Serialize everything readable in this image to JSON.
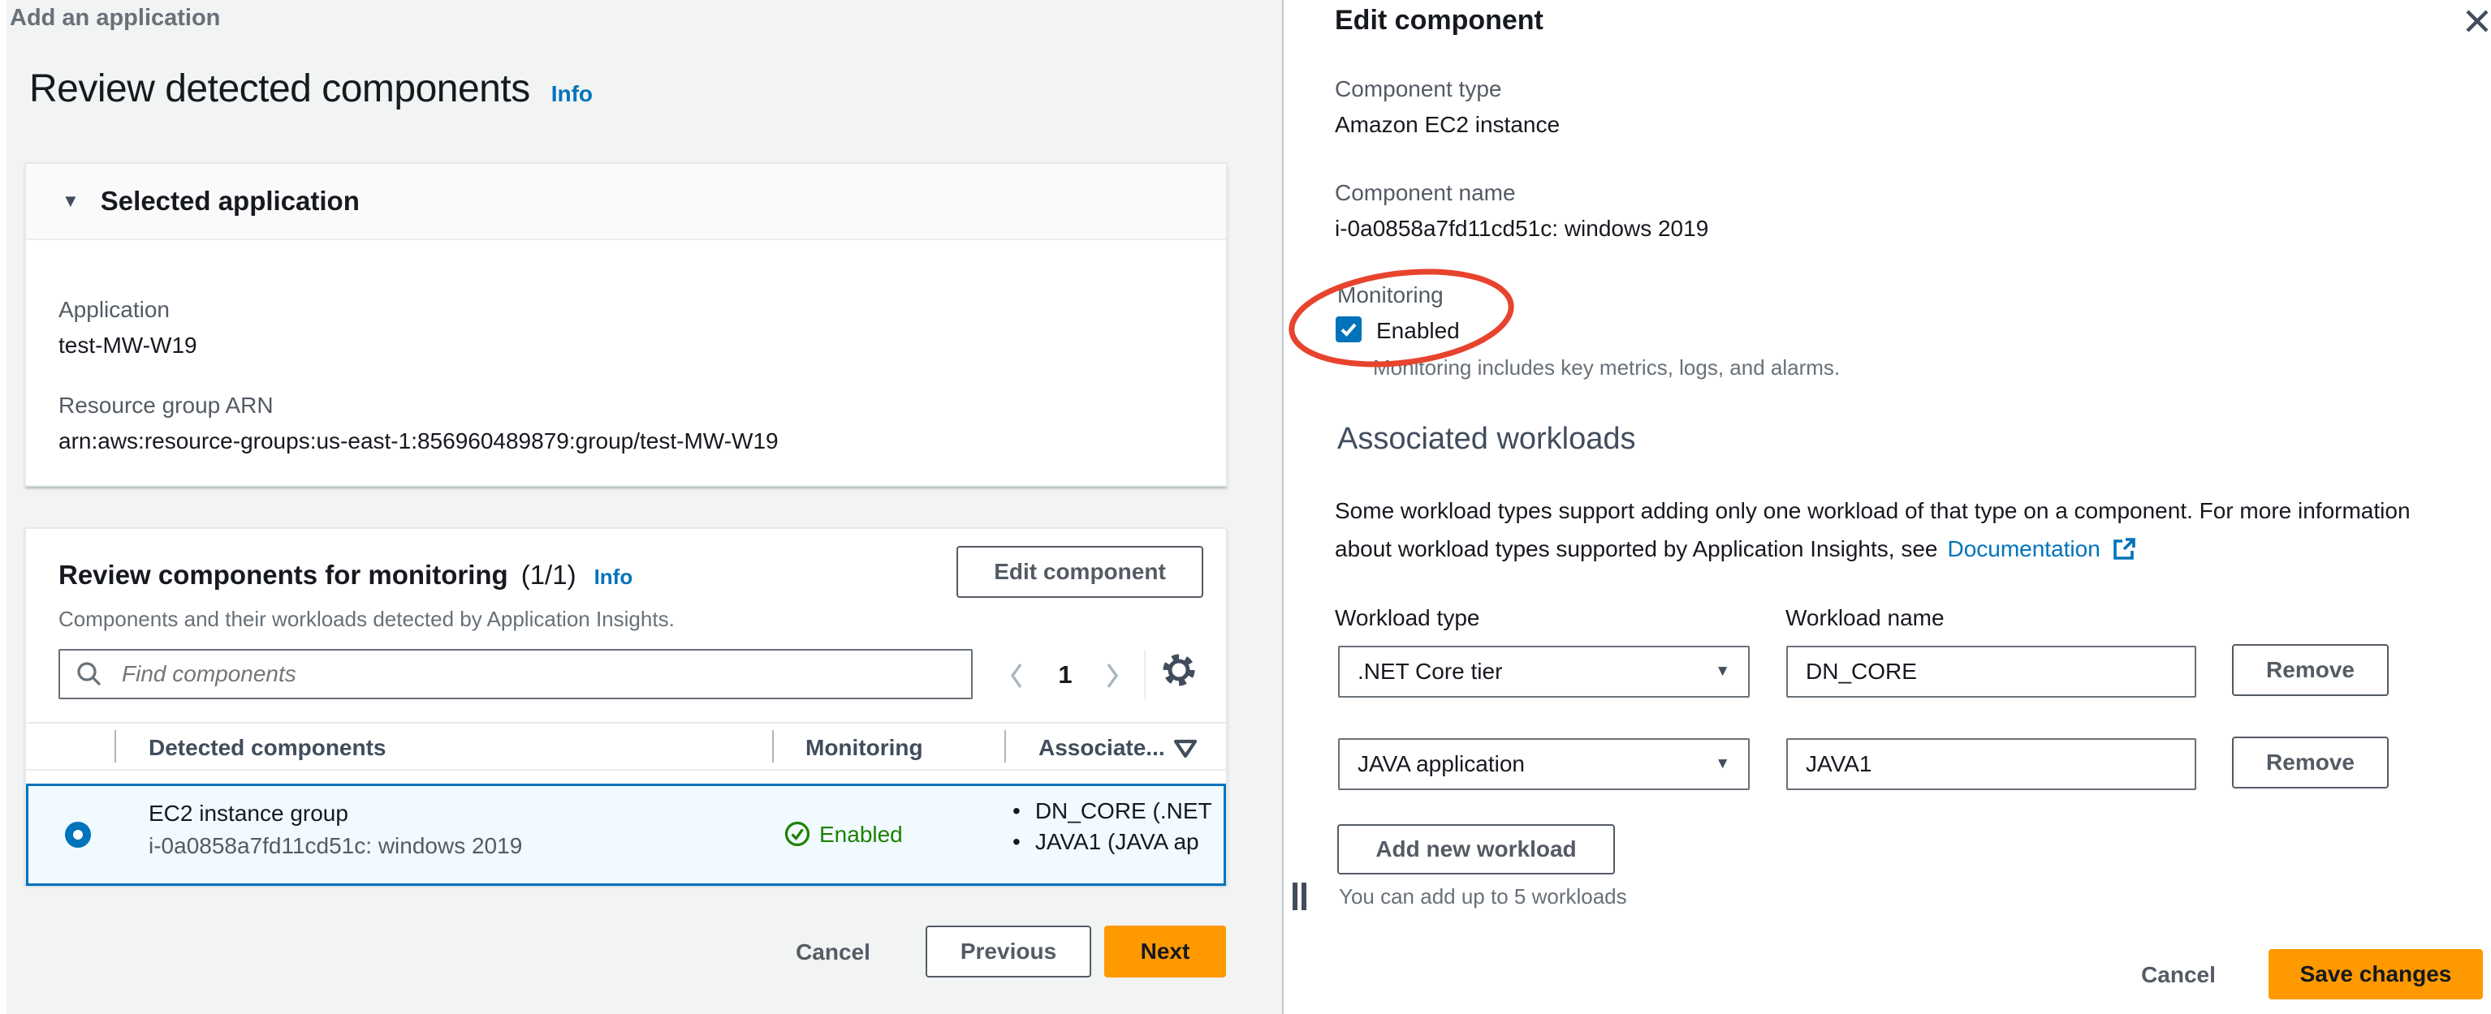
{
  "breadcrumb": "Add an application",
  "page": {
    "title": "Review detected components",
    "info_label": "Info"
  },
  "selected_application": {
    "title": "Selected application",
    "application_label": "Application",
    "application_value": "test-MW-W19",
    "arn_label": "Resource group ARN",
    "arn_value": "arn:aws:resource-groups:us-east-1:856960489879:group/test-MW-W19"
  },
  "review": {
    "title": "Review components for monitoring",
    "count": "(1/1)",
    "info_label": "Info",
    "description": "Components and their workloads detected by Application Insights.",
    "edit_button": "Edit component",
    "search_placeholder": "Find components",
    "page_number": "1",
    "table": {
      "headers": {
        "detected": "Detected components",
        "monitoring": "Monitoring",
        "associated": "Associate..."
      },
      "row": {
        "name": "EC2 instance group",
        "id": "i-0a0858a7fd11cd51c: windows 2019",
        "monitoring_status": "Enabled",
        "workload_1": "DN_CORE (.NET",
        "workload_2": "JAVA1 (JAVA ap"
      }
    },
    "footer": {
      "cancel": "Cancel",
      "previous": "Previous",
      "next": "Next"
    }
  },
  "panel": {
    "title": "Edit component",
    "component_type_label": "Component type",
    "component_type": "Amazon EC2 instance",
    "component_name_label": "Component name",
    "component_name": "i-0a0858a7fd11cd51c: windows 2019",
    "monitoring_label": "Monitoring",
    "monitoring_checkbox_label": "Enabled",
    "monitoring_help": "Monitoring includes key metrics, logs, and alarms.",
    "associated_title": "Associated workloads",
    "para_line1": "Some workload types support adding only one workload of that type on a component. For more information",
    "para_line2": "about workload types supported by Application Insights, see",
    "doc_link": "Documentation",
    "workload_type_label": "Workload type",
    "workload_name_label": "Workload name",
    "workloads": [
      {
        "type": ".NET Core tier",
        "name": "DN_CORE",
        "remove": "Remove"
      },
      {
        "type": "JAVA application",
        "name": "JAVA1",
        "remove": "Remove"
      }
    ],
    "add_button": "Add new workload",
    "limit_help": "You can add up to 5 workloads",
    "cancel": "Cancel",
    "save": "Save changes"
  },
  "icons": {
    "close": "x-icon",
    "search": "magnifier-icon",
    "settings": "gear-icon",
    "pagination_previous": "chevron-left-icon",
    "pagination_next": "chevron-right-icon",
    "filter": "funnel-triangle-icon",
    "status_enabled": "check-circle-icon",
    "external_link": "external-link-icon",
    "expander": "triangle-down-icon",
    "split_handle": "drag-bars-icon"
  },
  "colors": {
    "primary_button": "#ff9900",
    "link": "#0073bb",
    "status_enabled_green": "#1d8102",
    "selected_row_border": "#0073bb",
    "checkbox_blue": "#0073bb",
    "annotation_red": "#e8432d",
    "page_background": "#f2f3f3"
  }
}
